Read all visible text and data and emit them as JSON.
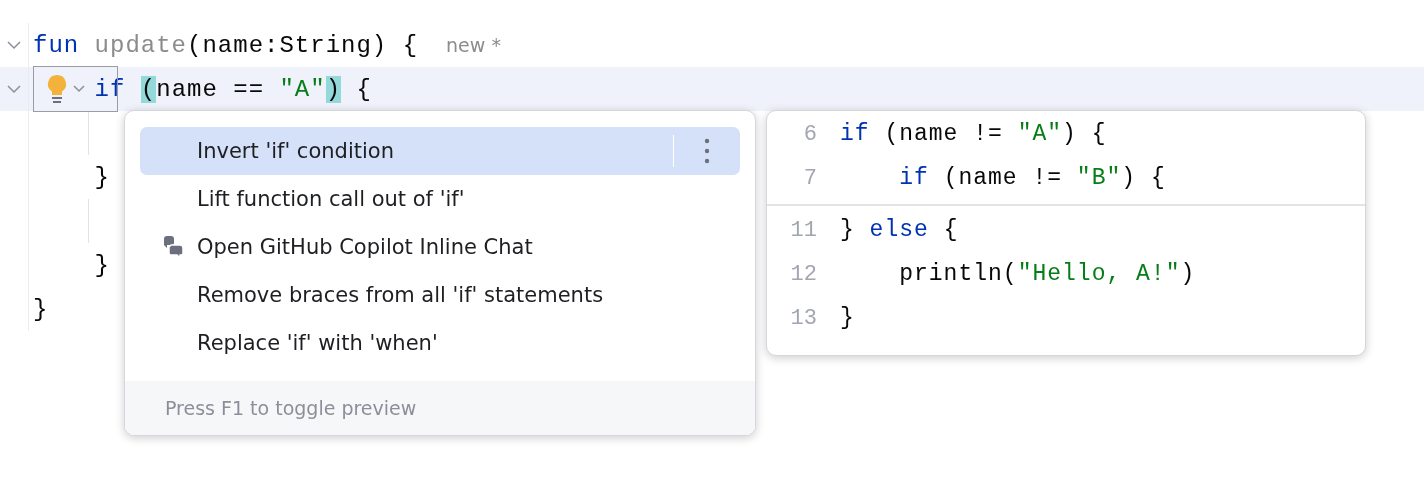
{
  "editor": {
    "lines": [
      {
        "foldable": true,
        "current": false,
        "tokens": [
          {
            "text": "fun ",
            "kind": "keyword"
          },
          {
            "text": "update",
            "kind": "unused"
          },
          {
            "text": "(name:String) {",
            "kind": "plain"
          }
        ],
        "hint": "new *"
      },
      {
        "foldable": true,
        "current": true,
        "tokens": [
          {
            "text": "    if ",
            "kind": "keyword"
          },
          {
            "text": "(",
            "kind": "match"
          },
          {
            "text": "name == ",
            "kind": "plain"
          },
          {
            "text": "\"A\"",
            "kind": "string"
          },
          {
            "text": ")",
            "kind": "match"
          },
          {
            "text": " {",
            "kind": "plain"
          }
        ]
      },
      {
        "foldable": false,
        "current": false,
        "tokens": [
          {
            "text": "    }",
            "kind": "plain"
          }
        ]
      },
      {
        "foldable": false,
        "current": false,
        "tokens": [
          {
            "text": "    }",
            "kind": "plain"
          }
        ]
      },
      {
        "foldable": false,
        "current": false,
        "tokens": [
          {
            "text": "}",
            "kind": "plain"
          }
        ]
      }
    ]
  },
  "intention_menu": {
    "items": [
      {
        "label": "Invert 'if' condition",
        "selected": true,
        "icon": false
      },
      {
        "label": "Lift function call out of 'if'",
        "selected": false,
        "icon": false
      },
      {
        "label": "Open GitHub Copilot Inline Chat",
        "selected": false,
        "icon": true
      },
      {
        "label": "Remove braces from all 'if' statements",
        "selected": false,
        "icon": false
      },
      {
        "label": "Replace 'if' with 'when'",
        "selected": false,
        "icon": false
      }
    ],
    "footer": "Press F1 to toggle preview"
  },
  "preview": {
    "sections": [
      {
        "lines": [
          {
            "number": "6",
            "tokens": [
              {
                "text": "if",
                "kind": "keyword"
              },
              {
                "text": " (name != ",
                "kind": "plain"
              },
              {
                "text": "\"A\"",
                "kind": "string"
              },
              {
                "text": ") {",
                "kind": "plain"
              }
            ]
          },
          {
            "number": "7",
            "tokens": [
              {
                "text": "    if",
                "kind": "keyword"
              },
              {
                "text": " (name != ",
                "kind": "plain"
              },
              {
                "text": "\"B\"",
                "kind": "string"
              },
              {
                "text": ") {",
                "kind": "plain"
              }
            ]
          }
        ]
      },
      {
        "lines": [
          {
            "number": "11",
            "tokens": [
              {
                "text": "} ",
                "kind": "plain"
              },
              {
                "text": "else",
                "kind": "keyword"
              },
              {
                "text": " {",
                "kind": "plain"
              }
            ]
          },
          {
            "number": "12",
            "tokens": [
              {
                "text": "    println(",
                "kind": "plain"
              },
              {
                "text": "\"Hello, A!\"",
                "kind": "string"
              },
              {
                "text": ")",
                "kind": "plain"
              }
            ]
          },
          {
            "number": "13",
            "tokens": [
              {
                "text": "}",
                "kind": "plain"
              }
            ]
          }
        ]
      }
    ]
  }
}
